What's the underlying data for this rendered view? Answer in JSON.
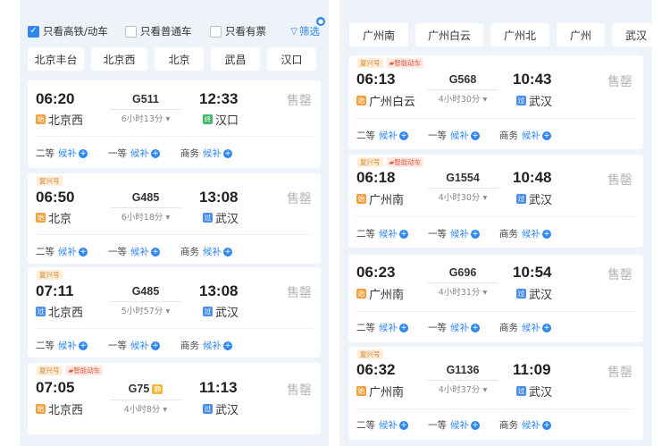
{
  "left": {
    "filters": [
      {
        "label": "只看高铁/动车",
        "checked": true
      },
      {
        "label": "只看普通车",
        "checked": false
      },
      {
        "label": "只看有票",
        "checked": false
      }
    ],
    "filter_button": "筛选",
    "stations": [
      "北京丰台",
      "北京西",
      "北京",
      "武昌",
      "汉口"
    ],
    "trains": [
      {
        "tags": [],
        "dep_time": "06:20",
        "train": "G511",
        "jing": "",
        "duration": "6小时13分",
        "dep_station": "北京西",
        "dep_badge": "始",
        "arr_time": "12:33",
        "arr_station": "汉口",
        "arr_badge": "终",
        "status": "售罄",
        "seats": [
          {
            "name": "二等",
            "wl": "候补"
          },
          {
            "name": "一等",
            "wl": "候补"
          },
          {
            "name": "商务",
            "wl": "候补"
          }
        ]
      },
      {
        "tags": [
          "复兴号"
        ],
        "dep_time": "06:50",
        "train": "G485",
        "jing": "",
        "duration": "6小时18分",
        "dep_station": "北京",
        "dep_badge": "始",
        "arr_time": "13:08",
        "arr_station": "武汉",
        "arr_badge": "过",
        "status": "售罄",
        "seats": [
          {
            "name": "二等",
            "wl": "候补"
          },
          {
            "name": "一等",
            "wl": "候补"
          },
          {
            "name": "商务",
            "wl": "候补"
          }
        ]
      },
      {
        "tags": [
          "复兴号"
        ],
        "dep_time": "07:11",
        "train": "G485",
        "jing": "",
        "duration": "5小时57分",
        "dep_station": "北京西",
        "dep_badge": "过",
        "arr_time": "13:08",
        "arr_station": "武汉",
        "arr_badge": "过",
        "status": "售罄",
        "seats": [
          {
            "name": "二等",
            "wl": "候补"
          },
          {
            "name": "一等",
            "wl": "候补"
          },
          {
            "name": "商务",
            "wl": "候补"
          }
        ]
      },
      {
        "tags": [
          "复兴号",
          "智能动车"
        ],
        "dep_time": "07:05",
        "train": "G75",
        "jing": "静",
        "duration": "4小时8分",
        "dep_station": "北京西",
        "dep_badge": "始",
        "arr_time": "11:13",
        "arr_station": "武汉",
        "arr_badge": "过",
        "status": "售罄",
        "seats": []
      }
    ]
  },
  "right": {
    "stations": [
      "广州南",
      "广州白云",
      "广州北",
      "广州",
      "武汉"
    ],
    "trains": [
      {
        "tags": [
          "复兴号",
          "智能动车"
        ],
        "dep_time": "06:13",
        "train": "G568",
        "jing": "",
        "duration": "4小时30分",
        "dep_station": "广州白云",
        "dep_badge": "始",
        "arr_time": "10:43",
        "arr_station": "武汉",
        "arr_badge": "过",
        "status": "售罄",
        "seats": [
          {
            "name": "二等",
            "wl": "候补"
          },
          {
            "name": "一等",
            "wl": "候补"
          },
          {
            "name": "商务",
            "wl": "候补"
          }
        ]
      },
      {
        "tags": [
          "复兴号",
          "智能动车"
        ],
        "dep_time": "06:18",
        "train": "G1554",
        "jing": "",
        "duration": "4小时30分",
        "dep_station": "广州南",
        "dep_badge": "始",
        "arr_time": "10:48",
        "arr_station": "武汉",
        "arr_badge": "过",
        "status": "售罄",
        "seats": [
          {
            "name": "二等",
            "wl": "候补"
          },
          {
            "name": "一等",
            "wl": "候补"
          },
          {
            "name": "商务",
            "wl": "候补"
          }
        ]
      },
      {
        "tags": [],
        "dep_time": "06:23",
        "train": "G696",
        "jing": "",
        "duration": "4小时31分",
        "dep_station": "广州南",
        "dep_badge": "始",
        "arr_time": "10:54",
        "arr_station": "武汉",
        "arr_badge": "过",
        "status": "售罄",
        "seats": [
          {
            "name": "二等",
            "wl": "候补"
          },
          {
            "name": "一等",
            "wl": "候补"
          },
          {
            "name": "商务",
            "wl": "候补"
          }
        ]
      },
      {
        "tags": [
          "复兴号"
        ],
        "dep_time": "06:32",
        "train": "G1136",
        "jing": "",
        "duration": "4小时37分",
        "dep_station": "广州南",
        "dep_badge": "始",
        "arr_time": "11:09",
        "arr_station": "武汉",
        "arr_badge": "过",
        "status": "售罄",
        "seats": [
          {
            "name": "二等",
            "wl": "候补"
          },
          {
            "name": "一等",
            "wl": "候补"
          },
          {
            "name": "商务",
            "wl": "候补"
          }
        ]
      }
    ]
  },
  "colors": {
    "accent": "#2e86f0",
    "soldout": "#b5b5b5",
    "tag_orange": "#d9822b"
  },
  "icons": {
    "filter": "funnel-icon",
    "waitlist": "plus-circle-icon",
    "dropdown": "caret-down-icon"
  }
}
